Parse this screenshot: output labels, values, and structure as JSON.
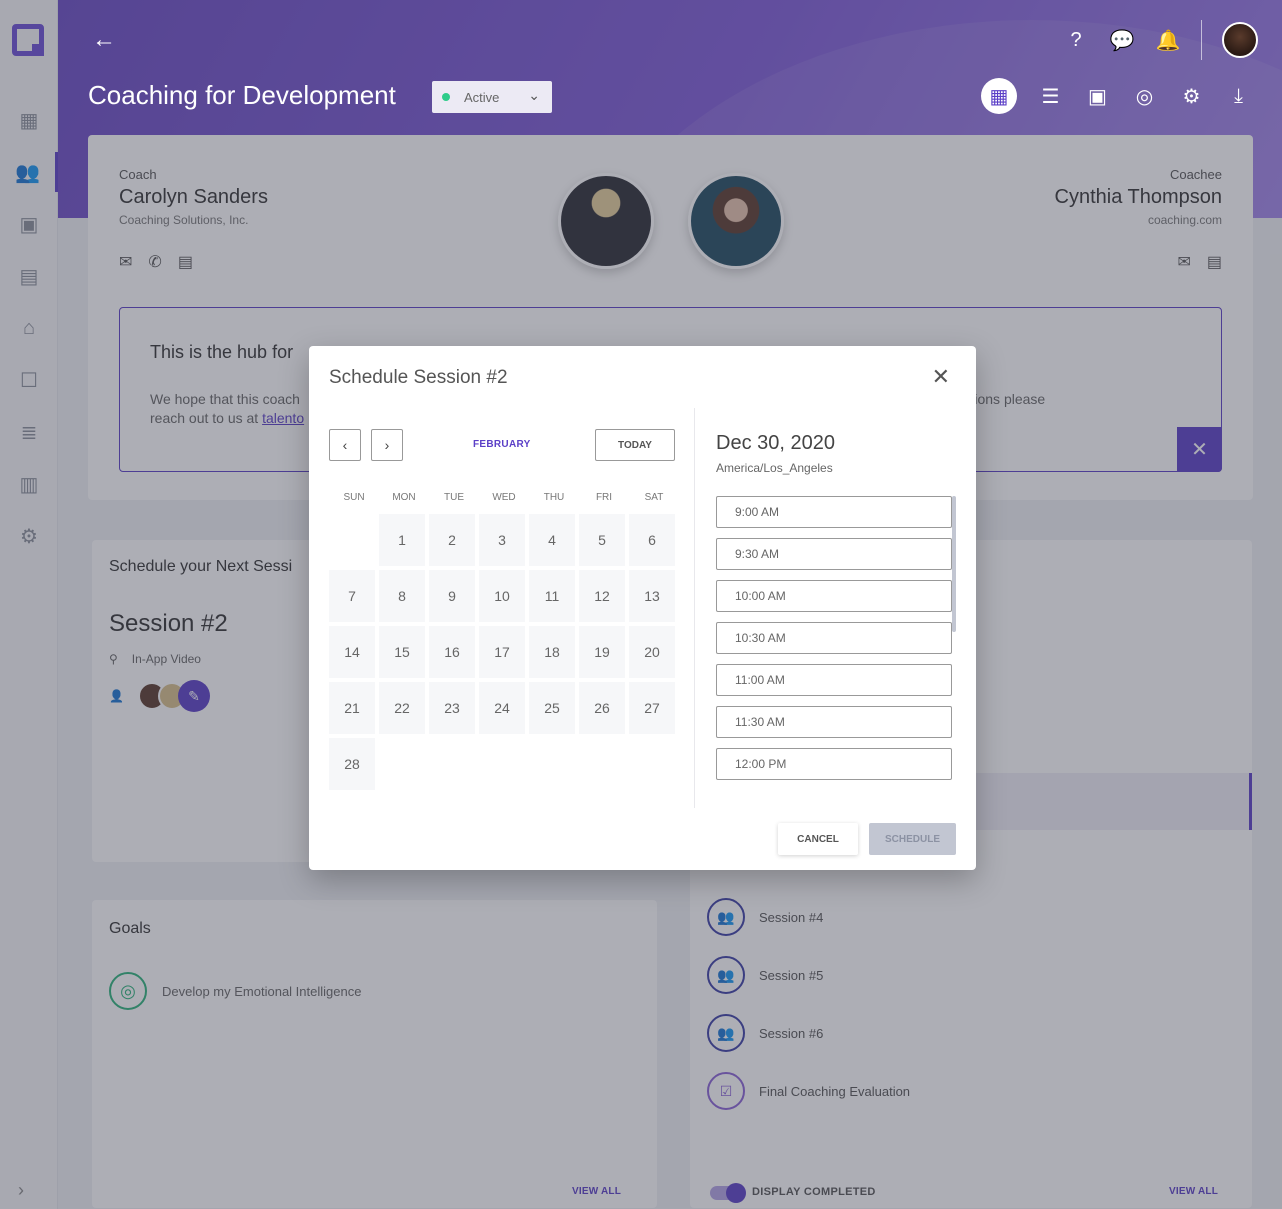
{
  "sidebar": {
    "items": [
      {
        "icon": "dashboard-icon",
        "glyph": "▦",
        "active": false
      },
      {
        "icon": "people-icon",
        "glyph": "👥",
        "active": true
      },
      {
        "icon": "library-icon",
        "glyph": "▣",
        "active": false
      },
      {
        "icon": "contacts-icon",
        "glyph": "▤",
        "active": false
      },
      {
        "icon": "store-icon",
        "glyph": "⌂",
        "active": false
      },
      {
        "icon": "profile-icon",
        "glyph": "☐",
        "active": false
      },
      {
        "icon": "list-icon",
        "glyph": "≣",
        "active": false
      },
      {
        "icon": "analytics-icon",
        "glyph": "▥",
        "active": false
      },
      {
        "icon": "settings-icon",
        "glyph": "⚙",
        "active": false
      }
    ],
    "expand_glyph": "›"
  },
  "header": {
    "back_glyph": "←",
    "title": "Coaching for Development",
    "status": {
      "value": "Active",
      "color": "#2ecc8a",
      "chevron": "⌄"
    },
    "top_icons": [
      {
        "name": "help-icon",
        "glyph": "?"
      },
      {
        "name": "chat-icon",
        "glyph": "💬"
      },
      {
        "name": "notifications-icon",
        "glyph": "🔔"
      }
    ],
    "view_icons": [
      {
        "name": "dashboard-view-icon",
        "glyph": "▦",
        "active": true
      },
      {
        "name": "list-view-icon",
        "glyph": "☰",
        "active": false
      },
      {
        "name": "portrait-view-icon",
        "glyph": "▣",
        "active": false
      },
      {
        "name": "target-view-icon",
        "glyph": "◎",
        "active": false
      },
      {
        "name": "settings-view-icon",
        "glyph": "⚙",
        "active": false
      },
      {
        "name": "download-icon",
        "glyph": "⤓",
        "active": false
      }
    ]
  },
  "hub": {
    "coach": {
      "label": "Coach",
      "name": "Carolyn Sanders",
      "org": "Coaching Solutions, Inc."
    },
    "coachee": {
      "label": "Coachee",
      "name": "Cynthia Thompson",
      "org": "coaching.com"
    },
    "title": "This is the hub for",
    "text_before": "We hope that this coach",
    "text_after": "u have any questions please",
    "text_line2": "reach out to us at ",
    "link": "talento",
    "close_glyph": "✕"
  },
  "next_session": {
    "title": "Schedule your Next Sessi",
    "session_name": "Session #2",
    "location": "In-App Video",
    "edit_glyph": "✎"
  },
  "timeline": {
    "items": [
      {
        "label": "Session #4",
        "type": "session"
      },
      {
        "label": "Session #5",
        "type": "session"
      },
      {
        "label": "Session #6",
        "type": "session"
      },
      {
        "label": "Final Coaching Evaluation",
        "type": "evaluation"
      }
    ],
    "display_completed": "DISPLAY COMPLETED",
    "display_completed_on": true,
    "view_all": "VIEW ALL"
  },
  "goals": {
    "title": "Goals",
    "items": [
      {
        "label": "Develop my Emotional Intelligence"
      }
    ],
    "view_all": "VIEW ALL"
  },
  "modal": {
    "title": "Schedule Session #2",
    "close_glyph": "✕",
    "prev_glyph": "‹",
    "next_glyph": "›",
    "month": "FEBRUARY",
    "today_label": "TODAY",
    "weekdays": [
      "SUN",
      "MON",
      "TUE",
      "WED",
      "THU",
      "FRI",
      "SAT"
    ],
    "first_weekday_offset": 1,
    "days_in_month": 28,
    "selected_date": "Dec 30, 2020",
    "timezone": "America/Los_Angeles",
    "time_slots": [
      "9:00 AM",
      "9:30 AM",
      "10:00 AM",
      "10:30 AM",
      "11:00 AM",
      "11:30 AM",
      "12:00 PM"
    ],
    "cancel_label": "CANCEL",
    "schedule_label": "SCHEDULE"
  }
}
